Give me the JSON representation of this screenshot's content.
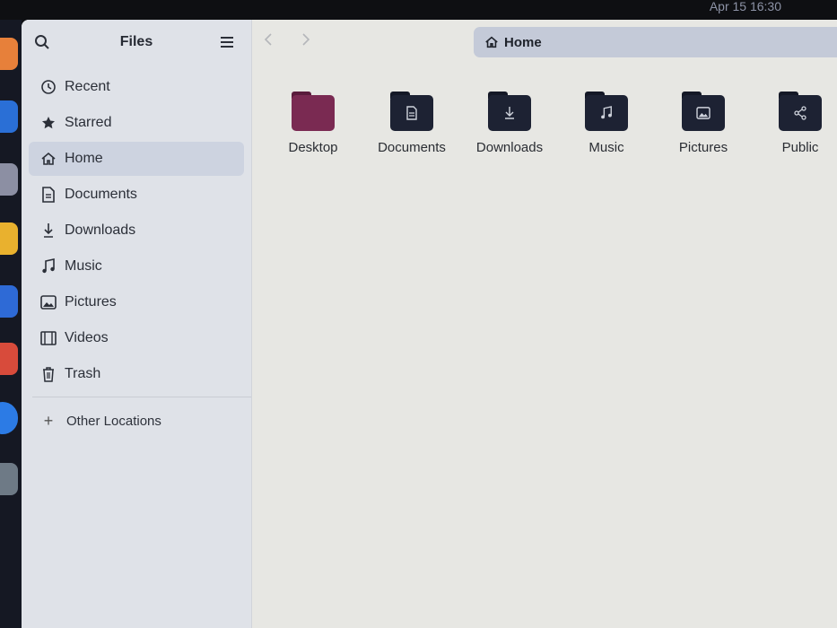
{
  "topbar": {
    "clock": "Apr 15  16:30"
  },
  "sidebar": {
    "title": "Files",
    "items": [
      {
        "label": "Recent",
        "icon": "clock-icon"
      },
      {
        "label": "Starred",
        "icon": "star-icon"
      },
      {
        "label": "Home",
        "icon": "home-icon",
        "active": true
      },
      {
        "label": "Documents",
        "icon": "document-icon"
      },
      {
        "label": "Downloads",
        "icon": "download-icon"
      },
      {
        "label": "Music",
        "icon": "music-note-icon"
      },
      {
        "label": "Pictures",
        "icon": "image-icon"
      },
      {
        "label": "Videos",
        "icon": "film-icon"
      },
      {
        "label": "Trash",
        "icon": "trash-icon"
      }
    ],
    "other_locations": "Other Locations"
  },
  "pathbar": {
    "label": "Home"
  },
  "folders": [
    {
      "label": "Desktop",
      "icon": "desktop-folder-icon"
    },
    {
      "label": "Documents",
      "icon": "document-folder-icon"
    },
    {
      "label": "Downloads",
      "icon": "download-folder-icon"
    },
    {
      "label": "Music",
      "icon": "music-folder-icon"
    },
    {
      "label": "Pictures",
      "icon": "pictures-folder-icon"
    },
    {
      "label": "Public",
      "icon": "share-folder-icon"
    }
  ],
  "colors": {
    "folder_dark": "#1d2233",
    "desktop_folder": "#7a2a52",
    "accent_selected": "#cdd3e0"
  }
}
